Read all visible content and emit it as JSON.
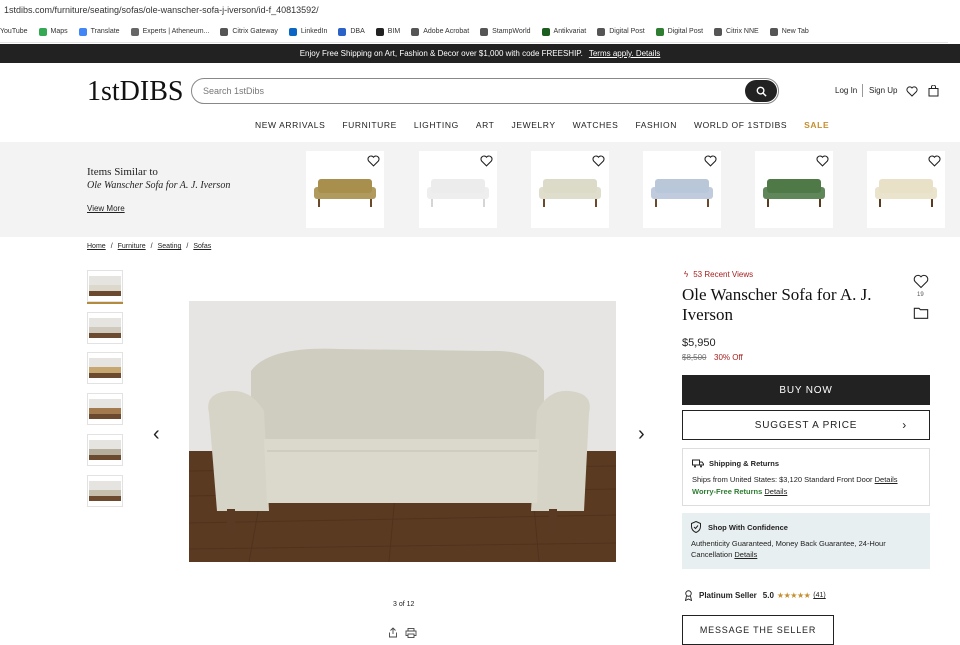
{
  "browser": {
    "url": "1stdibs.com/furniture/seating/sofas/ole-wanscher-sofa-j-iverson/id-f_40813592/",
    "bookmarks": [
      {
        "label": "YouTube",
        "color": "#e62117"
      },
      {
        "label": "Maps",
        "color": "#34a853"
      },
      {
        "label": "Translate",
        "color": "#4285f4"
      },
      {
        "label": "Experts | Atheneum...",
        "color": "#666666"
      },
      {
        "label": "Citrix Gateway",
        "color": "#555555"
      },
      {
        "label": "LinkedIn",
        "color": "#0a66c2"
      },
      {
        "label": "DBA",
        "color": "#2b62c7"
      },
      {
        "label": "BIM",
        "color": "#222222"
      },
      {
        "label": "Adobe Acrobat",
        "color": "#555555"
      },
      {
        "label": "StampWorld",
        "color": "#555555"
      },
      {
        "label": "Antikvariat",
        "color": "#1b5e20"
      },
      {
        "label": "Digital Post",
        "color": "#555555"
      },
      {
        "label": "Digital Post",
        "color": "#2e7d32"
      },
      {
        "label": "Citrix NNE",
        "color": "#555555"
      },
      {
        "label": "New Tab",
        "color": "#555555"
      }
    ]
  },
  "promo": {
    "text": "Enjoy Free Shipping on Art, Fashion & Decor over $1,000 with code FREESHIP.",
    "link": "Terms apply. Details"
  },
  "header": {
    "logo": "1stDIBS",
    "search_placeholder": "Search 1stDibs",
    "login": "Log In",
    "signup": "Sign Up",
    "nav": [
      "NEW ARRIVALS",
      "FURNITURE",
      "LIGHTING",
      "ART",
      "JEWELRY",
      "WATCHES",
      "FASHION",
      "WORLD OF 1STDIBS",
      "SALE"
    ]
  },
  "similar": {
    "title": "Items Similar to",
    "subtitle": "Ole Wanscher Sofa for A. J. Iverson",
    "view_more": "View More",
    "items": [
      {
        "fabric": "#a88f4d",
        "legs": "#6b4a2b"
      },
      {
        "fabric": "#ececec",
        "legs": "#d5d5d5"
      },
      {
        "fabric": "#dcdac8",
        "legs": "#6b4a2b"
      },
      {
        "fabric": "#b9c7d9",
        "legs": "#6b4a2b"
      },
      {
        "fabric": "#4f7a48",
        "legs": "#5a3b22"
      },
      {
        "fabric": "#e8e1c8",
        "legs": "#5a3b22"
      }
    ]
  },
  "breadcrumbs": [
    "Home",
    "Furniture",
    "Seating",
    "Sofas"
  ],
  "gallery": {
    "counter": "3 of 12",
    "thumbs": 6,
    "selected_thumb": 1
  },
  "product": {
    "recent_views": "53 Recent Views",
    "title": "Ole Wanscher Sofa for A. J. Iverson",
    "favorites": "19",
    "price": "$5,950",
    "old_price": "$8,500",
    "discount": "30% Off",
    "buy_now": "BUY NOW",
    "suggest_price": "SUGGEST A PRICE",
    "shipping_heading": "Shipping & Returns",
    "ships_from": "Ships from United States: $3,120 Standard Front Door",
    "ships_details": "Details",
    "returns": "Worry-Free Returns",
    "returns_details": "Details",
    "confidence_heading": "Shop With Confidence",
    "confidence_text": "Authenticity Guaranteed, Money Back Guarantee, 24-Hour Cancellation",
    "confidence_details": "Details",
    "seller_tier": "Platinum Seller",
    "seller_rating": "5.0",
    "seller_stars": "★★★★★",
    "seller_reviews": "(41)",
    "message_seller": "MESSAGE THE SELLER"
  }
}
